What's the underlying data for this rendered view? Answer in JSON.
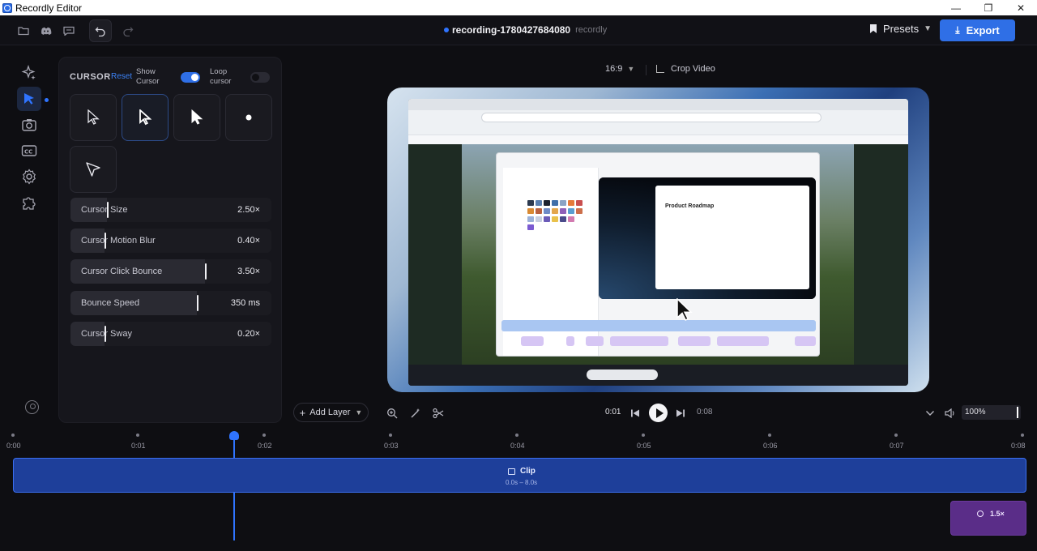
{
  "window": {
    "title": "Recordly Editor",
    "controls": [
      "—",
      "❐",
      "✕"
    ]
  },
  "header": {
    "project_name": "recording-1780427684080",
    "project_tag": "recordly",
    "presets_label": "Presets",
    "export_label": "Export"
  },
  "rail": {
    "items": [
      "sparkles-icon",
      "cursor-icon",
      "camera-icon",
      "captions-icon",
      "settings-icon",
      "puzzle-icon"
    ],
    "active": "cursor-icon"
  },
  "panel": {
    "title": "CURSOR",
    "reset_label": "Reset",
    "show_cursor_label": "Show Cursor",
    "show_cursor_on": true,
    "loop_cursor_label": "Loop cursor",
    "loop_cursor_on": false,
    "cursor_styles": [
      "arrow-outline",
      "arrow-outline-bold",
      "arrow-filled",
      "dot",
      "arrow-tip"
    ],
    "selected_style": "arrow-outline-bold",
    "sliders": [
      {
        "label": "Cursor Size",
        "value": "2.50×",
        "level": 0.18
      },
      {
        "label": "Cursor Motion Blur",
        "value": "0.40×",
        "level": 0.17
      },
      {
        "label": "Cursor Click Bounce",
        "value": "3.50×",
        "level": 0.67
      },
      {
        "label": "Bounce Speed",
        "value": "350 ms",
        "level": 0.63
      },
      {
        "label": "Cursor Sway",
        "value": "0.20×",
        "level": 0.17
      }
    ]
  },
  "preview": {
    "aspect_label": "16:9",
    "crop_label": "Crop Video",
    "inner_title": "Product Roadmap"
  },
  "transport": {
    "add_layer_label": "Add Layer",
    "current_time": "0:01",
    "end_time": "0:08",
    "zoom_value": "100%"
  },
  "timeline": {
    "ticks": [
      "0:00",
      "0:01",
      "0:02",
      "0:03",
      "0:04",
      "0:05",
      "0:06",
      "0:07",
      "0:08"
    ],
    "playhead_time": 1.77,
    "clip": {
      "label": "Clip",
      "range": "0.0s – 8.0s"
    },
    "zoom_clip": {
      "label": "1.5×"
    }
  },
  "colors": {
    "accent": "#2f6fe6",
    "clip": "#1e3f9a",
    "zoom_clip": "#5a2d88"
  }
}
